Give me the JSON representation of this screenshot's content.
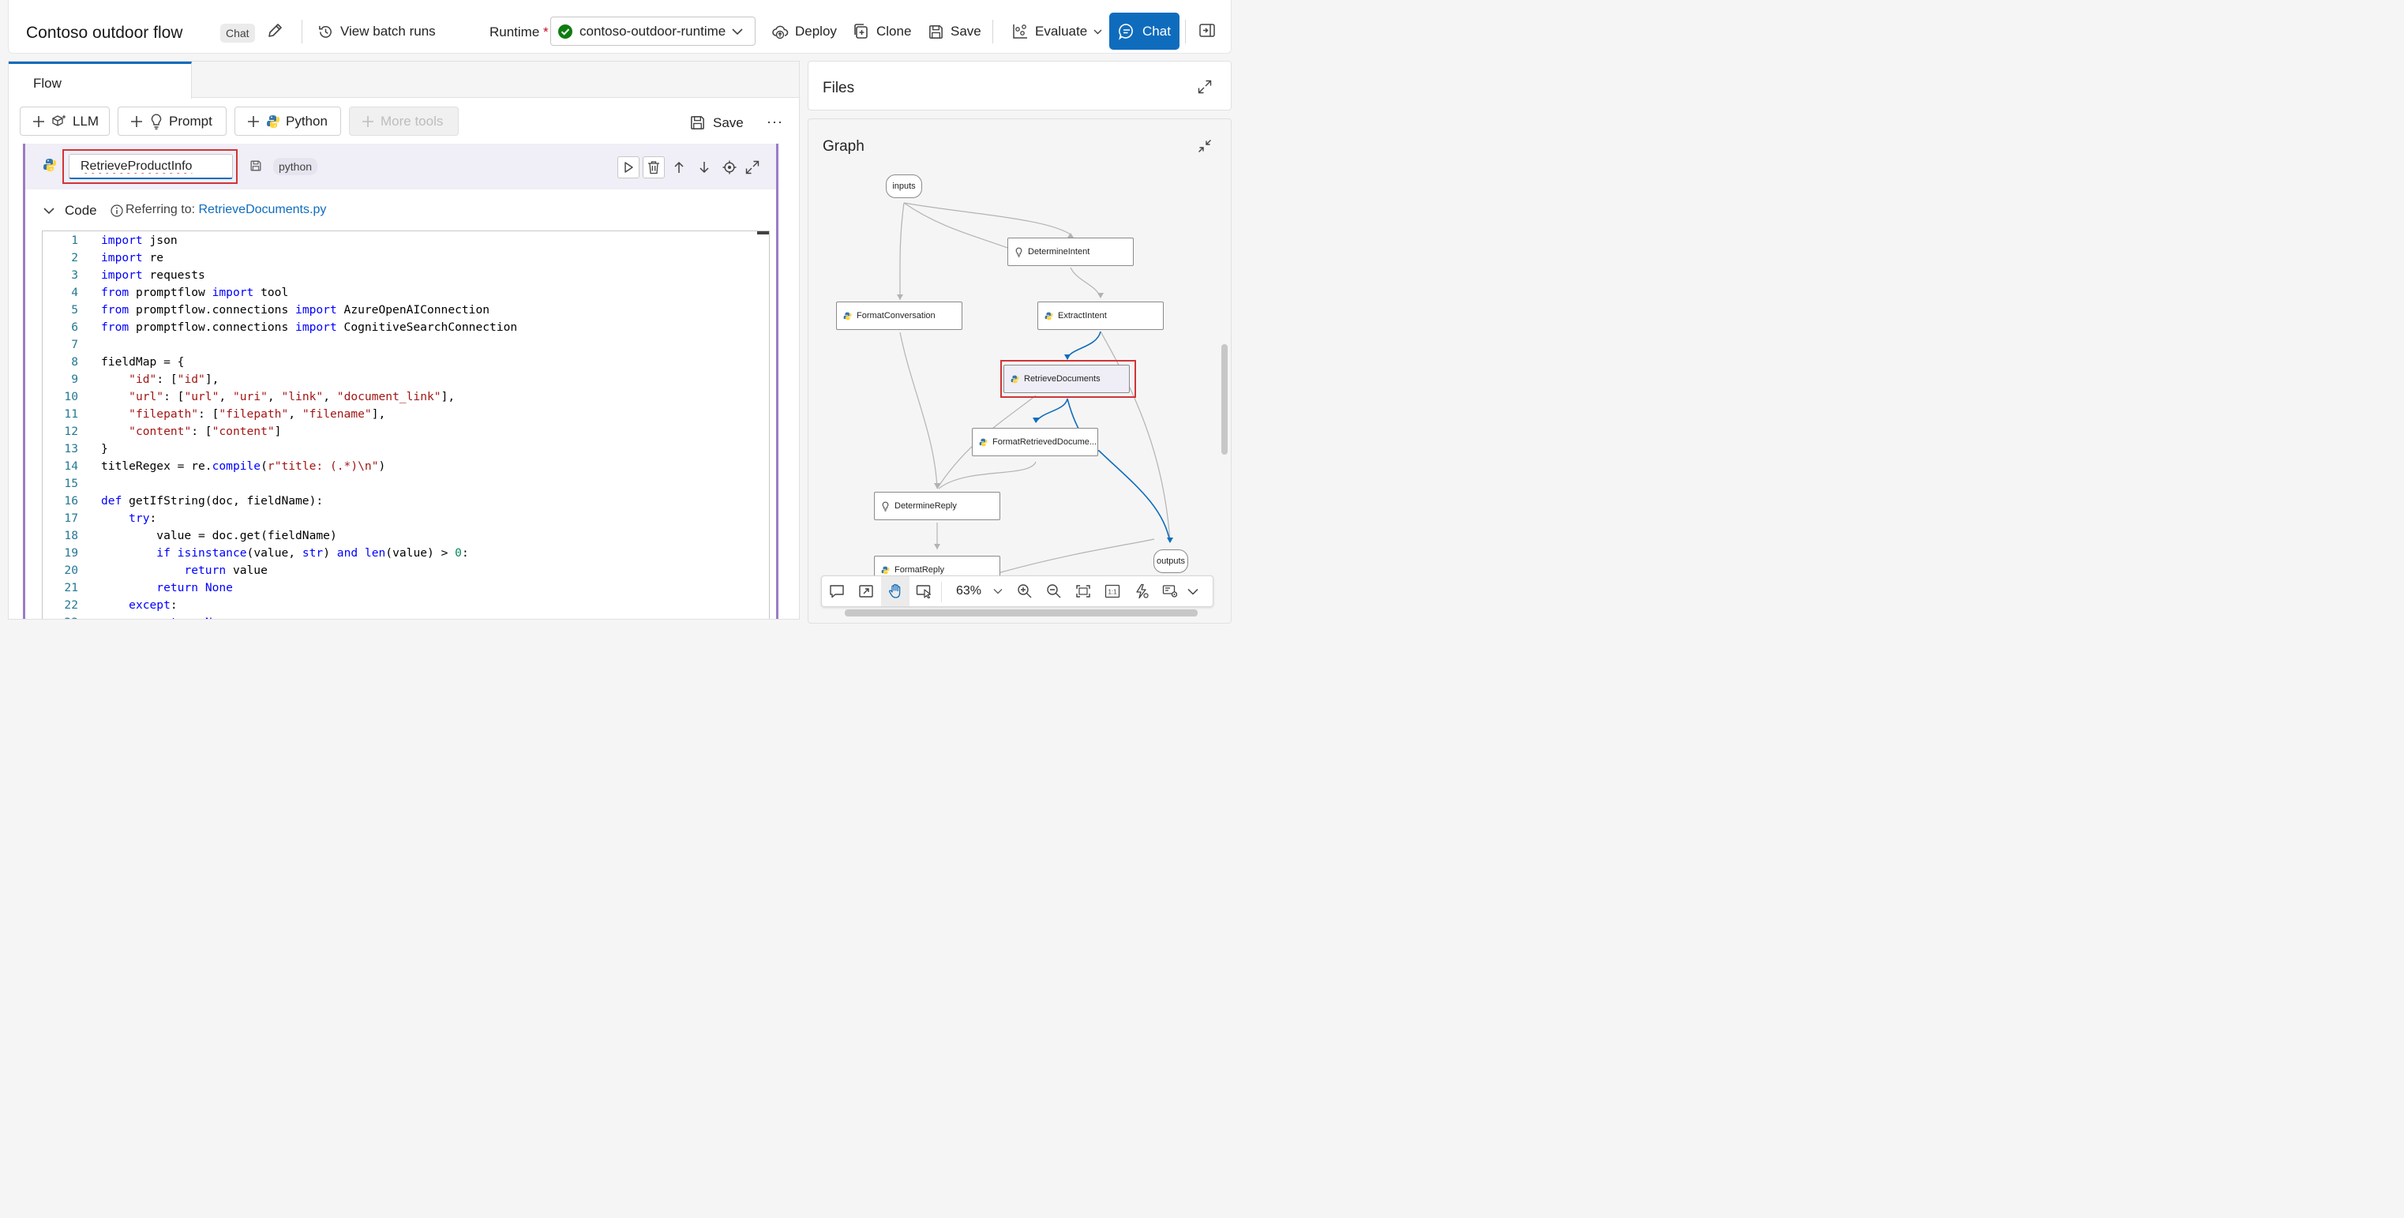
{
  "header": {
    "flow_title": "Contoso outdoor flow",
    "type_chip": "Chat",
    "view_batch_runs": "View batch runs",
    "runtime_label": "Runtime",
    "runtime_required": "*",
    "runtime_value": "contoso-outdoor-runtime",
    "deploy": "Deploy",
    "clone": "Clone",
    "save": "Save",
    "evaluate": "Evaluate",
    "chat": "Chat"
  },
  "left": {
    "tab": "Flow",
    "tools": {
      "llm": "LLM",
      "prompt": "Prompt",
      "python": "Python",
      "more_tools": "More tools",
      "save": "Save",
      "more": "···"
    },
    "node": {
      "name": "RetrieveProductInfo",
      "type_chip": "python",
      "code_label": "Code",
      "referring_to": "Referring to:",
      "file_link": "RetrieveDocuments.py"
    },
    "code_lines": [
      "import json",
      "import re",
      "import requests",
      "from promptflow import tool",
      "from promptflow.connections import AzureOpenAIConnection",
      "from promptflow.connections import CognitiveSearchConnection",
      "",
      "fieldMap = {",
      "    \"id\": [\"id\"],",
      "    \"url\": [\"url\", \"uri\", \"link\", \"document_link\"],",
      "    \"filepath\": [\"filepath\", \"filename\"],",
      "    \"content\": [\"content\"]",
      "}",
      "titleRegex = re.compile(r\"title: (.*)\\n\")",
      "",
      "def getIfString(doc, fieldName):",
      "    try:",
      "        value = doc.get(fieldName)",
      "        if isinstance(value, str) and len(value) > 0:",
      "            return value",
      "        return None",
      "    except:",
      "        return None"
    ]
  },
  "files": {
    "title": "Files"
  },
  "graph": {
    "title": "Graph",
    "zoom": "63%",
    "nodes": {
      "inputs": "inputs",
      "determine_intent": "DetermineIntent",
      "format_conversation": "FormatConversation",
      "extract_intent": "ExtractIntent",
      "retrieve_documents": "RetrieveDocuments",
      "format_retrieved": "FormatRetrievedDocume...",
      "determine_reply": "DetermineReply",
      "format_reply": "FormatReply",
      "outputs": "outputs"
    },
    "colors": {
      "edge": "#b3b3b3",
      "highlight_edge": "#0f6cbd",
      "selection": "#d13438"
    }
  }
}
